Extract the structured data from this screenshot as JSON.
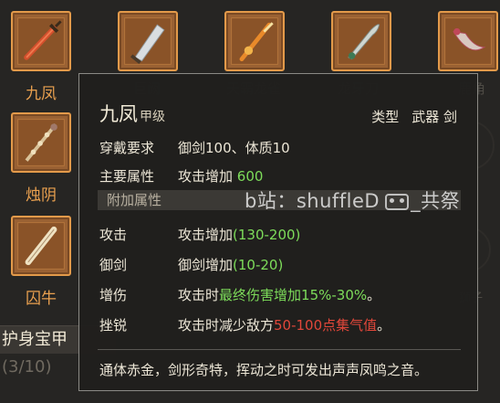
{
  "slots_top": [
    {
      "name": "九凤",
      "icon": "red-sword-icon"
    },
    {
      "name": "",
      "icon": "silver-broadsword-icon"
    },
    {
      "name": "",
      "icon": "golden-spear-icon"
    },
    {
      "name": "",
      "icon": "curved-blade-icon"
    },
    {
      "name": "",
      "icon": "crescent-blade-icon"
    }
  ],
  "slots_side": [
    {
      "name": "烛阴",
      "icon": "bone-staff-icon"
    },
    {
      "name": "囚牛",
      "icon": "bone-flute-icon"
    }
  ],
  "bottom_title": "护身宝甲",
  "bottom_count": "(3/10)",
  "tooltip": {
    "name": "九凤",
    "grade": "甲级",
    "type_label": "类型",
    "type_value": "武器 剑",
    "requirement_label": "穿戴要求",
    "requirement_value": "御剑100、体质10",
    "main_attr_label": "主要属性",
    "main_attr_text": "攻击增加",
    "main_attr_value": "600",
    "extra_section": "附加属性",
    "extra": [
      {
        "label": "攻击",
        "text": "攻击增加",
        "value": "(130-200)"
      },
      {
        "label": "御剑",
        "text": "御剑增加",
        "value": "(10-20)"
      }
    ],
    "zengshang_label": "增伤",
    "zengshang_pre": "攻击时",
    "zengshang_mid": "最终伤害增加",
    "zengshang_val": "15%-30%",
    "zengshang_end": "。",
    "cuorui_label": "挫锐",
    "cuorui_pre": "攻击时减少敌方",
    "cuorui_val": "50-100点集气值",
    "cuorui_end": "。",
    "description": "通体赤金，剑形奇特，挥动之时可发出声声凤鸣之音。"
  },
  "watermark": {
    "prefix": "b站：shuffleD",
    "suffix": "_共祭"
  },
  "colors": {
    "accent": "#e39a4a",
    "green": "#7ddc5a",
    "red": "#e0473a"
  }
}
